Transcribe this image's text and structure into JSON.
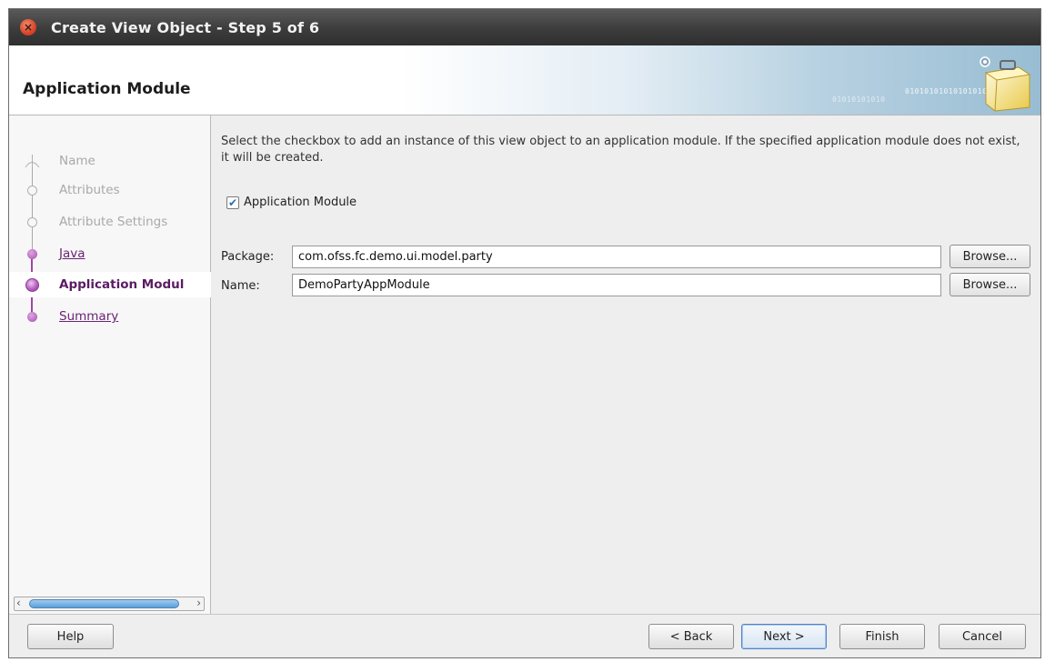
{
  "window": {
    "title": "Create View Object - Step 5 of 6"
  },
  "header": {
    "title": "Application Module",
    "binary_text": "0101010101010101010101",
    "binary_text2": "01010101010"
  },
  "steps": [
    {
      "label": "Name",
      "state": "disabled"
    },
    {
      "label": "Attributes",
      "state": "disabled"
    },
    {
      "label": "Attribute Settings",
      "state": "disabled"
    },
    {
      "label": "Java",
      "state": "link"
    },
    {
      "label": "Application Modul",
      "state": "active"
    },
    {
      "label": "Summary",
      "state": "link"
    }
  ],
  "content": {
    "description": "Select the checkbox to add an instance of this view object to an application module.  If the specified application module does not exist, it will be created.",
    "checkbox": {
      "label": "Application Module",
      "checked": true
    },
    "package": {
      "label": "Package:",
      "value": "com.ofss.fc.demo.ui.model.party",
      "browse_label": "Browse..."
    },
    "name": {
      "label": "Name:",
      "value": "DemoPartyAppModule",
      "browse_label": "Browse..."
    }
  },
  "footer": {
    "help": "Help",
    "back": "< Back",
    "next": "Next >",
    "finish": "Finish",
    "cancel": "Cancel"
  },
  "colors": {
    "titlebar": "#3c3c3c",
    "active_step": "#5a1c63",
    "link_step": "#6a2475",
    "disabled_step": "#a9a9a9"
  }
}
